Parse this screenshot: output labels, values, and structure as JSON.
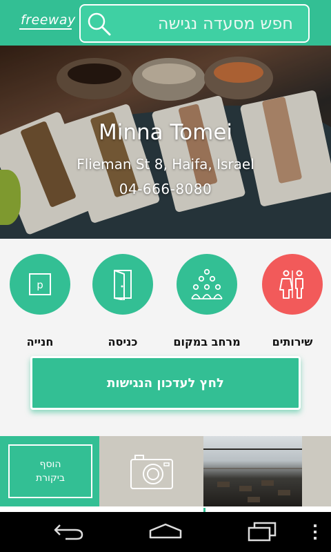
{
  "app": {
    "logo": "freeway",
    "search_placeholder": "חפש מסעדה נגישה"
  },
  "restaurant": {
    "name": "Minna Tomei",
    "address": "Flieman St 8, Haifa, Israel",
    "phone": "04-666-8080"
  },
  "features": [
    {
      "label": "שירותים",
      "icon": "restroom-icon",
      "status_color": "#f25a5a"
    },
    {
      "label": "מרחב במקום",
      "icon": "people-space-icon",
      "status_color": "#33bf94"
    },
    {
      "label": "כניסה",
      "icon": "door-icon",
      "status_color": "#33bf94"
    },
    {
      "label": "חנייה",
      "icon": "parking-icon",
      "status_color": "#33bf94"
    }
  ],
  "update_button": "לחץ לעדכון הנגישות",
  "review": {
    "line1": "הוסף",
    "line2": "ביקורת"
  },
  "colors": {
    "brand": "#33bf94",
    "alert": "#f25a5a"
  },
  "system_nav": {
    "back": "back-icon",
    "home": "home-icon",
    "recents": "recents-icon"
  }
}
